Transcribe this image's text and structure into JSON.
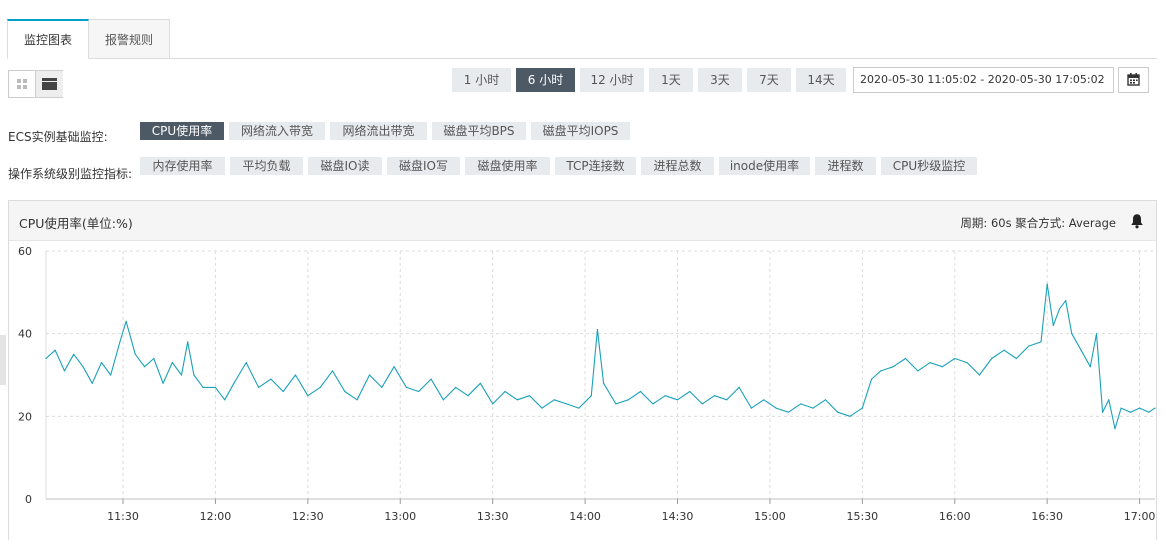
{
  "tabs": [
    {
      "label": "监控图表",
      "active": true
    },
    {
      "label": "报警规则",
      "active": false
    }
  ],
  "time_ranges": [
    {
      "label": "1 小时",
      "active": false
    },
    {
      "label": "6 小时",
      "active": true
    },
    {
      "label": "12 小时",
      "active": false
    },
    {
      "label": "1天",
      "active": false
    },
    {
      "label": "3天",
      "active": false
    },
    {
      "label": "7天",
      "active": false
    },
    {
      "label": "14天",
      "active": false
    }
  ],
  "date_range": "2020-05-30 11:05:02 - 2020-05-30 17:05:02",
  "ecs_row": {
    "label": "ECS实例基础监控:",
    "items": [
      {
        "label": "CPU使用率",
        "active": true
      },
      {
        "label": "网络流入带宽",
        "active": false
      },
      {
        "label": "网络流出带宽",
        "active": false
      },
      {
        "label": "磁盘平均BPS",
        "active": false
      },
      {
        "label": "磁盘平均IOPS",
        "active": false
      }
    ]
  },
  "os_row": {
    "label": "操作系统级别监控指标:",
    "items": [
      {
        "label": "内存使用率",
        "active": false
      },
      {
        "label": "平均负载",
        "active": false
      },
      {
        "label": "磁盘IO读",
        "active": false
      },
      {
        "label": "磁盘IO写",
        "active": false
      },
      {
        "label": "磁盘使用率",
        "active": false
      },
      {
        "label": "TCP连接数",
        "active": false
      },
      {
        "label": "进程总数",
        "active": false
      },
      {
        "label": "inode使用率",
        "active": false
      },
      {
        "label": "进程数",
        "active": false
      },
      {
        "label": "CPU秒级监控",
        "active": false
      }
    ]
  },
  "panel": {
    "title": "CPU使用率(单位:%)",
    "meta": "周期: 60s   聚合方式: Average"
  },
  "chart_data": {
    "type": "line",
    "title": "CPU使用率(单位:%)",
    "color": "#1aa1b8",
    "ylim": [
      0,
      60
    ],
    "yticks": [
      0,
      20,
      40,
      60
    ],
    "xlim": [
      "11:05",
      "17:05"
    ],
    "xticks": [
      "11:30",
      "12:00",
      "12:30",
      "13:00",
      "13:30",
      "14:00",
      "14:30",
      "15:00",
      "15:30",
      "16:00",
      "16:30",
      "17:00"
    ],
    "grid": true,
    "series": [
      {
        "points": [
          [
            "11:05",
            34
          ],
          [
            "11:08",
            36
          ],
          [
            "11:11",
            31
          ],
          [
            "11:14",
            35
          ],
          [
            "11:17",
            32
          ],
          [
            "11:20",
            28
          ],
          [
            "11:23",
            33
          ],
          [
            "11:26",
            30
          ],
          [
            "11:29",
            38
          ],
          [
            "11:31",
            43
          ],
          [
            "11:34",
            35
          ],
          [
            "11:37",
            32
          ],
          [
            "11:40",
            34
          ],
          [
            "11:43",
            28
          ],
          [
            "11:46",
            33
          ],
          [
            "11:49",
            30
          ],
          [
            "11:51",
            38
          ],
          [
            "11:53",
            30
          ],
          [
            "11:56",
            27
          ],
          [
            "12:00",
            27
          ],
          [
            "12:03",
            24
          ],
          [
            "12:06",
            28
          ],
          [
            "12:10",
            33
          ],
          [
            "12:14",
            27
          ],
          [
            "12:18",
            29
          ],
          [
            "12:22",
            26
          ],
          [
            "12:26",
            30
          ],
          [
            "12:30",
            25
          ],
          [
            "12:34",
            27
          ],
          [
            "12:38",
            31
          ],
          [
            "12:42",
            26
          ],
          [
            "12:46",
            24
          ],
          [
            "12:50",
            30
          ],
          [
            "12:54",
            27
          ],
          [
            "12:58",
            32
          ],
          [
            "13:02",
            27
          ],
          [
            "13:06",
            26
          ],
          [
            "13:10",
            29
          ],
          [
            "13:14",
            24
          ],
          [
            "13:18",
            27
          ],
          [
            "13:22",
            25
          ],
          [
            "13:26",
            28
          ],
          [
            "13:30",
            23
          ],
          [
            "13:34",
            26
          ],
          [
            "13:38",
            24
          ],
          [
            "13:42",
            25
          ],
          [
            "13:46",
            22
          ],
          [
            "13:50",
            24
          ],
          [
            "13:54",
            23
          ],
          [
            "13:58",
            22
          ],
          [
            "14:02",
            25
          ],
          [
            "14:04",
            41
          ],
          [
            "14:06",
            28
          ],
          [
            "14:10",
            23
          ],
          [
            "14:14",
            24
          ],
          [
            "14:18",
            26
          ],
          [
            "14:22",
            23
          ],
          [
            "14:26",
            25
          ],
          [
            "14:30",
            24
          ],
          [
            "14:34",
            26
          ],
          [
            "14:38",
            23
          ],
          [
            "14:42",
            25
          ],
          [
            "14:46",
            24
          ],
          [
            "14:50",
            27
          ],
          [
            "14:54",
            22
          ],
          [
            "14:58",
            24
          ],
          [
            "15:02",
            22
          ],
          [
            "15:06",
            21
          ],
          [
            "15:10",
            23
          ],
          [
            "15:14",
            22
          ],
          [
            "15:18",
            24
          ],
          [
            "15:22",
            21
          ],
          [
            "15:26",
            20
          ],
          [
            "15:30",
            22
          ],
          [
            "15:33",
            29
          ],
          [
            "15:36",
            31
          ],
          [
            "15:40",
            32
          ],
          [
            "15:44",
            34
          ],
          [
            "15:48",
            31
          ],
          [
            "15:52",
            33
          ],
          [
            "15:56",
            32
          ],
          [
            "16:00",
            34
          ],
          [
            "16:04",
            33
          ],
          [
            "16:08",
            30
          ],
          [
            "16:12",
            34
          ],
          [
            "16:16",
            36
          ],
          [
            "16:20",
            34
          ],
          [
            "16:24",
            37
          ],
          [
            "16:28",
            38
          ],
          [
            "16:30",
            52
          ],
          [
            "16:32",
            42
          ],
          [
            "16:34",
            46
          ],
          [
            "16:36",
            48
          ],
          [
            "16:38",
            40
          ],
          [
            "16:41",
            36
          ],
          [
            "16:44",
            32
          ],
          [
            "16:46",
            40
          ],
          [
            "16:48",
            21
          ],
          [
            "16:50",
            24
          ],
          [
            "16:52",
            17
          ],
          [
            "16:54",
            22
          ],
          [
            "16:57",
            21
          ],
          [
            "17:00",
            22
          ],
          [
            "17:03",
            21
          ],
          [
            "17:05",
            22
          ]
        ]
      }
    ]
  }
}
